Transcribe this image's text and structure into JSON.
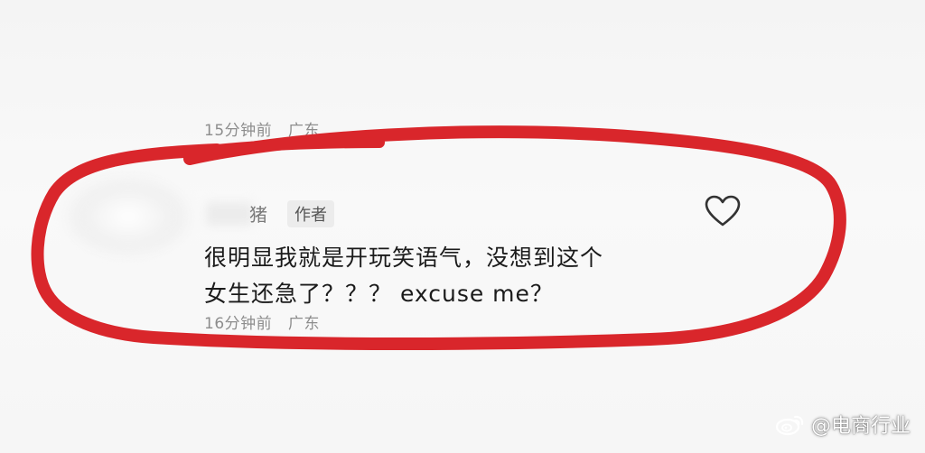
{
  "previous_comment": {
    "time": "15分钟前",
    "location": "广东"
  },
  "comment": {
    "username_visible": "猪",
    "author_badge": "作者",
    "text_lines": [
      "很明显我就是开玩笑语气，没想到这个",
      "女生还急了？？？ excuse me？"
    ],
    "time": "16分钟前",
    "location": "广东",
    "like_icon": "heart-outline-icon"
  },
  "annotation": {
    "color": "#d9262b"
  },
  "watermark": {
    "logo_icon": "weibo-logo-icon",
    "text": "@电商行业"
  }
}
